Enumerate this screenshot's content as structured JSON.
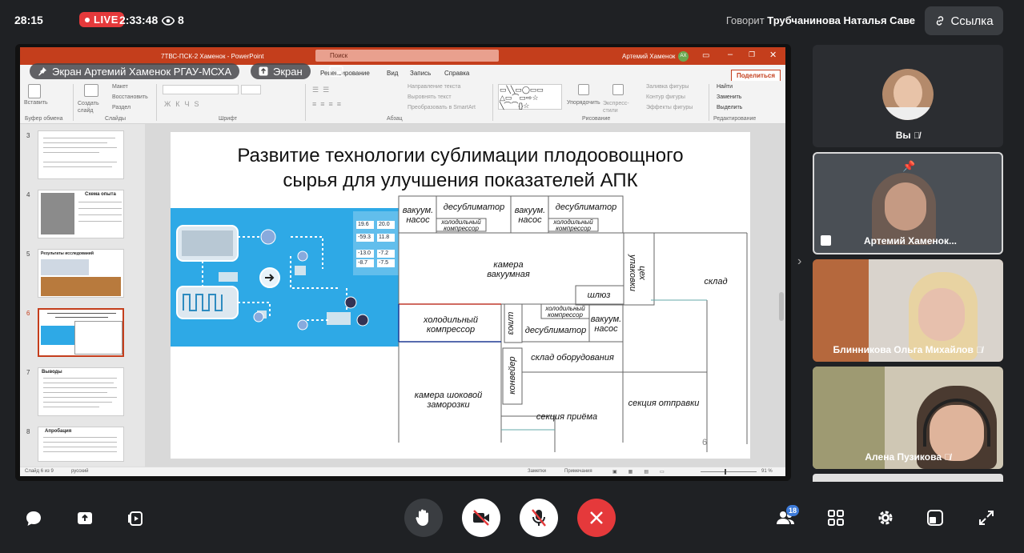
{
  "topbar": {
    "clock": "28:15",
    "live_label": "LIVE",
    "elapsed": "2:33:48",
    "viewers": "8",
    "speaking_prefix": "Говорит",
    "speaking_name": "Трубчанинова Наталья Саве",
    "link_label": "Ссылка"
  },
  "share": {
    "presenter_label": "Экран Артемий Хаменок РГАУ-МСХА",
    "screen_label": "Экран"
  },
  "powerpoint": {
    "title": "7ТВС-ПСК-2 Хаменок  -  PowerPoint",
    "search_placeholder": "Поиск",
    "user": "Артемий Хаменок",
    "user_initials": "АХ",
    "menu": [
      "Рецензирование",
      "Вид",
      "Запись",
      "Справка"
    ],
    "share_label": "Поделиться",
    "ribbon": {
      "insert": "Вставить",
      "create_slide": "Создать слайд",
      "layout": "Макет",
      "restore": "Восстановить",
      "section": "Раздел",
      "text_direction": "Направление текста",
      "align_text": "Выровнять текст",
      "smartart": "Преобразовать в SmartArt",
      "arrange": "Упорядочить",
      "quick_styles": "Экспресс-стили",
      "fill": "Заливка фигуры",
      "outline": "Контур фигуры",
      "effects": "Эффекты фигуры",
      "find": "Найти",
      "replace": "Заменить",
      "select": "Выделить",
      "groups": [
        "Буфер обмена",
        "Слайды",
        "Шрифт",
        "Абзац",
        "Рисование",
        "Редактирование"
      ]
    },
    "thumbnails": [
      {
        "num": "3",
        "title": ""
      },
      {
        "num": "4",
        "title": "Схема опыта"
      },
      {
        "num": "5",
        "title": "Результаты исследований"
      },
      {
        "num": "6",
        "title": ""
      },
      {
        "num": "7",
        "title": "Выводы"
      },
      {
        "num": "8",
        "title": "Апробация"
      }
    ],
    "slide": {
      "title_line1": "Развитие технологии сублимации плодоовощного",
      "title_line2": "сырья для улучшения показателей АПК",
      "page_number": "6",
      "diagram_values": [
        [
          "19.6",
          "20.0"
        ],
        [
          "-59.3",
          "11.8"
        ],
        [
          "-13.0",
          "-7.2"
        ],
        [
          "-8.7",
          "-7.5"
        ]
      ],
      "plan_labels": {
        "vacuum_pump_1": "вакуум. насос",
        "desublimator_1": "десублиматор",
        "fridge_comp_small_1": "холодильный компрессор",
        "vacuum_pump_2": "вакуум. насос",
        "desublimator_2": "десублиматор",
        "fridge_comp_small_2": "холодильный компрессор",
        "vacuum_chamber": "камера вакуумная",
        "packaging_shop": "цех упаковки",
        "warehouse": "склад",
        "airlock_1": "шлюз",
        "fridge_compressor": "холодильный компрессор",
        "airlock_2": "шлюз",
        "fridge_comp_small_3": "холодильный компрессор",
        "desublimator_3": "десублиматор",
        "vacuum_pump_3": "вакуум. насос",
        "equipment_storage": "склад оборудования",
        "conveyor": "конвейер",
        "shock_freeze": "камера шоковой заморозки",
        "reception": "секция приёма",
        "shipping": "секция отправки"
      }
    },
    "status": {
      "slide_info": "Слайд 6 из 9",
      "language": "русский",
      "notes": "Заметки",
      "comments": "Примечания",
      "zoom": "91 %"
    }
  },
  "participants": [
    {
      "name": "Вы"
    },
    {
      "name": "Артемий Хаменок..."
    },
    {
      "name": "Блинникова Ольга Михайлов"
    },
    {
      "name": "Алена Пузикова"
    }
  ],
  "bottom": {
    "participants_count": "18"
  }
}
